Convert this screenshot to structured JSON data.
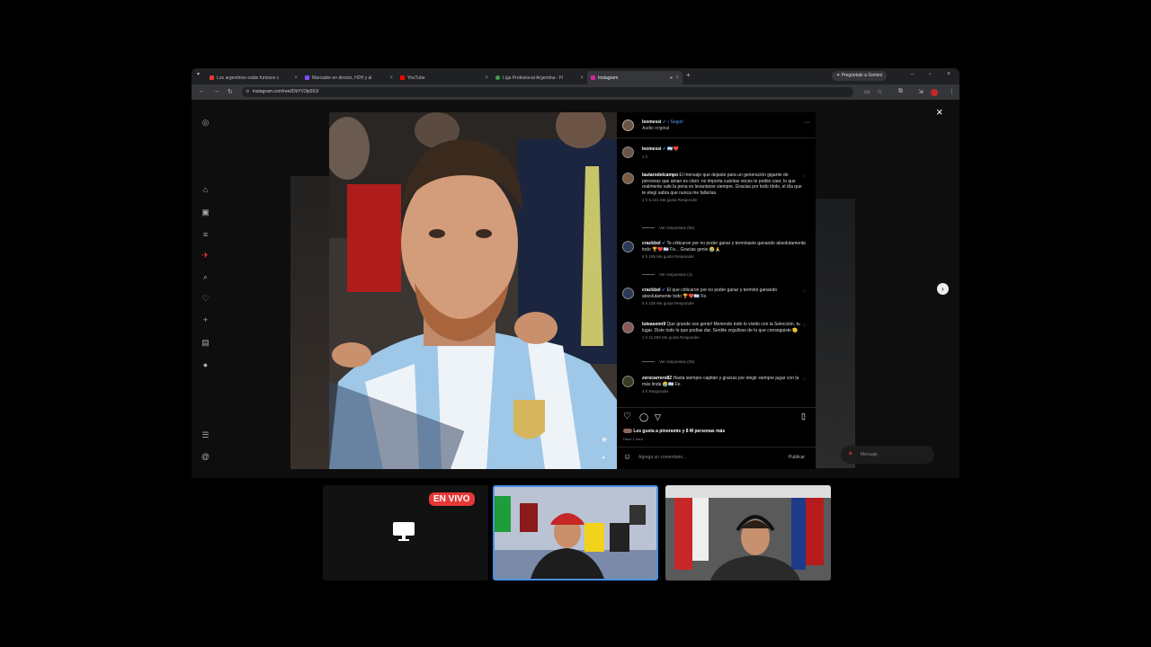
{
  "browser": {
    "tabs": [
      {
        "label": "Los argentinos están furiosos c",
        "color": "#e53935"
      },
      {
        "label": "Marcador en directo, H2H y al",
        "color": "#7c4dff"
      },
      {
        "label": "YouTube",
        "color": "#ff0000"
      },
      {
        "label": "Liga Profesional Argentina - Fl",
        "color": "#43a047"
      },
      {
        "label": "Instagram",
        "color": "#d6249f"
      }
    ],
    "gemini_label": "Pregúntale a Gemini",
    "url": "instagram.com/reel/DbYV2tp93J/"
  },
  "post": {
    "author": "leomessi",
    "follow": "Seguir",
    "audio": "Audio original",
    "caption": "🇦🇷❤️",
    "caption_time": "1 h",
    "comments": [
      {
        "user": "lautarodelcampo",
        "text": "El mensaje que dejaste para un generación gigante de personas que aman es claro: no importa cuántas veces te podés caer, lo que realmente vale la pena es levantarse siempre. Gracias por todo ídolo, el día que te elegí sabía que nunca me fallarías.",
        "meta": "1 h   5.441 Me gusta   Responder",
        "replies": "Ver respuestas (55)"
      },
      {
        "user": "crackbol",
        "text": "Te criticaron por no poder ganar y terminaste ganando absolutamente todo 🏆❤️🇦🇷 Fe... Gracias genio 😭🙏",
        "meta": "6 h   185 Me gusta   Responder",
        "replies": "Ver respuestas (4)"
      },
      {
        "user": "crackbol",
        "text": "El que criticaron por no poder ganar y terminó ganando absolutamente todo 🏆❤️🇦🇷 Fe.",
        "meta": "6 h   105 Me gusta   Responder",
        "replies": ""
      },
      {
        "user": "luteasenn9",
        "text": "Que grande sos genio! Moriendo todo lo vivido con la Selección, tu lugar. Diste todo lo que podías dar. Sentite orgulloso de lo que conseguiste 🫡",
        "meta": "1 h   11.650 Me gusta   Responder",
        "replies": "Ver respuestas (29)"
      },
      {
        "user": "zerocarrero82",
        "text": "Hasta siempre capitán y gracias por elegir siempre jugar con la más linda 😭🇦🇷 Fe.",
        "meta": "4 h   Responder",
        "replies": ""
      }
    ],
    "likes_text": "Les gusta a pinoramis y 8 M personas más",
    "likes_time": "Hace 1 hora",
    "comment_placeholder": "Agrega un comentario...",
    "publish": "Publicar",
    "message_label": "Mensaje"
  },
  "stream": {
    "live_badge": "EN VIVO"
  }
}
